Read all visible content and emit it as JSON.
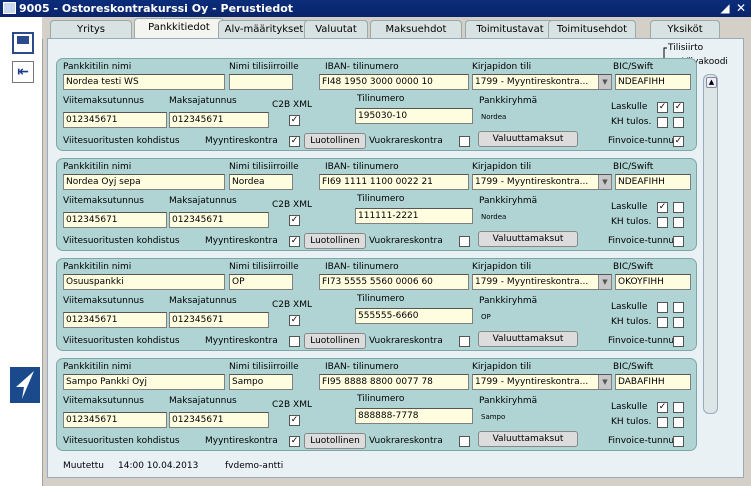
{
  "window": {
    "title": "9005 - Ostoreskontrakurssi Oy - Perustiedot",
    "buttons": [
      "◢",
      "✕"
    ]
  },
  "tabs": [
    "Yritys",
    "Pankkitiedot",
    "Alv-määritykset",
    "Valuutat",
    "Maksuehdot",
    "Toimitustavat",
    "Toimitusehdot",
    "Yksiköt"
  ],
  "active_tab": "Pankkitiedot",
  "header_notes": {
    "tilisiirto": "Tilisiirto",
    "viivakoodi": "Viivakoodi"
  },
  "labels": {
    "pankkitilin_nimi": "Pankkitilin nimi",
    "nimi_tilisiirroille": "Nimi tilisiirroille",
    "iban": "IBAN- tilinumero",
    "kirjapidon_tili": "Kirjapidon tili",
    "bic": "BIC/Swift",
    "viitemaksutunnus": "Viitemaksutunnus",
    "maksajatunnus": "Maksajatunnus",
    "c2b_xml": "C2B XML",
    "tilinumero": "Tilinumero",
    "pankkiryhma": "Pankkiryhmä",
    "laskulle": "Laskulle",
    "kh_tulos": "KH tulos.",
    "viitesuoritusten": "Viitesuoritusten kohdistus",
    "myyntireskontra": "Myyntireskontra",
    "luotollinen": "Luotollinen",
    "vuokrareskontra": "Vuokrareskontra",
    "valuuttamaksut": "Valuuttamaksut",
    "finvoice": "Finvoice-tunnus"
  },
  "accounts": [
    {
      "nimi": "Nordea testi WS",
      "nimi_tilisiirroille": "",
      "iban": "FI48 1950 3000 0000 10",
      "kirjapidon_tili": "1799 - Myyntireskontra...",
      "bic": "NDEAFIHH",
      "viitemaksutunnus": "012345671",
      "maksajatunnus": "012345671",
      "c2b_xml": true,
      "tilinumero": "195030-10",
      "pankkiryhma": "Nordea",
      "laskulle_tilisiirto": true,
      "laskulle_viivakoodi": true,
      "kh_tulos_1": false,
      "kh_tulos_2": false,
      "myyntireskontra": true,
      "vuokrareskontra": false,
      "finvoice": true
    },
    {
      "nimi": "Nordea Oyj sepa",
      "nimi_tilisiirroille": "Nordea",
      "iban": "FI69 1111 1100 0022 21",
      "kirjapidon_tili": "1799 - Myyntireskontra...",
      "bic": "NDEAFIHH",
      "viitemaksutunnus": "012345671",
      "maksajatunnus": "012345671",
      "c2b_xml": true,
      "tilinumero": "111111-2221",
      "pankkiryhma": "Nordea",
      "laskulle_tilisiirto": true,
      "laskulle_viivakoodi": false,
      "kh_tulos_1": false,
      "kh_tulos_2": false,
      "myyntireskontra": true,
      "vuokrareskontra": false,
      "finvoice": false
    },
    {
      "nimi": "Osuuspankki",
      "nimi_tilisiirroille": "OP",
      "iban": "FI73 5555 5560 0006 60",
      "kirjapidon_tili": "1799 - Myyntireskontra...",
      "bic": "OKOYFIHH",
      "viitemaksutunnus": "012345671",
      "maksajatunnus": "012345671",
      "c2b_xml": true,
      "tilinumero": "555555-6660",
      "pankkiryhma": "OP",
      "laskulle_tilisiirto": false,
      "laskulle_viivakoodi": false,
      "kh_tulos_1": false,
      "kh_tulos_2": false,
      "myyntireskontra": false,
      "vuokrareskontra": false,
      "finvoice": false
    },
    {
      "nimi": "Sampo Pankki Oyj",
      "nimi_tilisiirroille": "Sampo",
      "iban": "FI95 8888 8800 0077 78",
      "kirjapidon_tili": "1799 - Myyntireskontra...",
      "bic": "DABAFIHH",
      "viitemaksutunnus": "012345671",
      "maksajatunnus": "012345671",
      "c2b_xml": true,
      "tilinumero": "888888-7778",
      "pankkiryhma": "Sampo",
      "laskulle_tilisiirto": true,
      "laskulle_viivakoodi": false,
      "kh_tulos_1": false,
      "kh_tulos_2": false,
      "myyntireskontra": true,
      "vuokrareskontra": false,
      "finvoice": false
    }
  ],
  "footer": {
    "label": "Muutettu",
    "timestamp": "14:00 10.04.2013",
    "user": "fvdemo-antti"
  }
}
